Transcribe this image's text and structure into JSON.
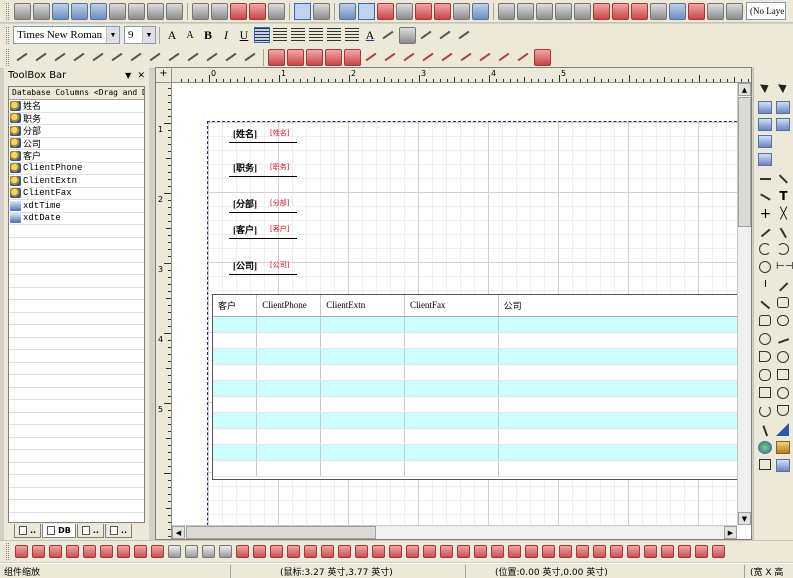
{
  "toolbar1": {
    "layer_combo_value": "(No Laye"
  },
  "format_bar": {
    "font_family": "Times New Roman",
    "font_size": "9",
    "bold_label": "B",
    "italic_label": "I",
    "underline_label": "U"
  },
  "toolbox": {
    "title": "ToolBox Bar",
    "pin_glyph": "▼",
    "close_glyph": "✕",
    "header": "Database Columns <Drag and Drop>",
    "items": [
      {
        "label": "姓名",
        "kind": "field"
      },
      {
        "label": "职务",
        "kind": "field"
      },
      {
        "label": "分部",
        "kind": "field"
      },
      {
        "label": "公司",
        "kind": "field"
      },
      {
        "label": "客户",
        "kind": "field"
      },
      {
        "label": "ClientPhone",
        "kind": "field"
      },
      {
        "label": "ClientExtn",
        "kind": "field"
      },
      {
        "label": "ClientFax",
        "kind": "field"
      },
      {
        "label": "xdtTime",
        "kind": "system"
      },
      {
        "label": "xdtDate",
        "kind": "system"
      }
    ],
    "tabs": [
      {
        "label": "..",
        "active": false
      },
      {
        "label": "DB",
        "active": true
      },
      {
        "label": "..",
        "active": false
      },
      {
        "label": "..",
        "active": false
      }
    ]
  },
  "ruler": {
    "h_numbers": [
      "0",
      "1",
      "2",
      "3",
      "4",
      "5"
    ],
    "v_numbers": [
      "1",
      "2",
      "3",
      "4",
      "5"
    ]
  },
  "design": {
    "fields": [
      {
        "label": "[姓名]",
        "value": "[姓名]"
      },
      {
        "label": "[职务]",
        "value": "[职务]"
      },
      {
        "label": "[分部]",
        "value": "[分部]"
      },
      {
        "label": "[客户]",
        "value": "[客户]"
      },
      {
        "label": "[公司]",
        "value": "[公司]"
      }
    ],
    "grid": {
      "columns": [
        "客户",
        "ClientPhone",
        "ClientExtn",
        "ClientFax",
        "公司"
      ]
    }
  },
  "status": {
    "left": "组件缩放",
    "mouse": "(鼠标:3.27 英寸,3.77 英寸)",
    "position": "(位置:0.00 英寸,0.00 英寸)",
    "size": "(宽 X 高"
  }
}
